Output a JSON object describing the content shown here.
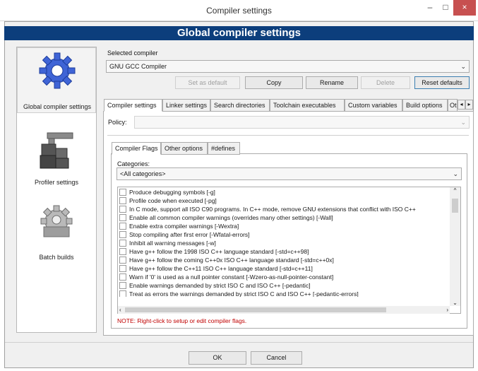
{
  "window": {
    "title": "Compiler settings",
    "minimize": "–",
    "maximize": "□",
    "close": "×"
  },
  "banner": "Global compiler settings",
  "sidebar": {
    "items": [
      {
        "label": "Global compiler settings",
        "icon": "gear-icon",
        "selected": true
      },
      {
        "label": "Profiler settings",
        "icon": "caliper-icon",
        "selected": false
      },
      {
        "label": "Batch builds",
        "icon": "gears-icon",
        "selected": false
      }
    ]
  },
  "selected_compiler": {
    "label": "Selected compiler",
    "value": "GNU GCC Compiler",
    "buttons": {
      "set_default": "Set as default",
      "copy": "Copy",
      "rename": "Rename",
      "delete": "Delete",
      "reset": "Reset defaults"
    }
  },
  "tabs": [
    "Compiler settings",
    "Linker settings",
    "Search directories",
    "Toolchain executables",
    "Custom variables",
    "Build options",
    "Other settings"
  ],
  "policy": {
    "label": "Policy:",
    "value": ""
  },
  "subtabs": [
    "Compiler Flags",
    "Other options",
    "#defines"
  ],
  "categories": {
    "label": "Categories:",
    "value": "<All categories>"
  },
  "flags": [
    "Produce debugging symbols  [-g]",
    "Profile code when executed  [-pg]",
    "In C mode, support all ISO C90 programs. In C++ mode, remove GNU extensions that conflict with ISO C++",
    "Enable all common compiler warnings (overrides many other settings)  [-Wall]",
    "Enable extra compiler warnings  [-Wextra]",
    "Stop compiling after first error  [-Wfatal-errors]",
    "Inhibit all warning messages  [-w]",
    "Have g++ follow the 1998 ISO C++ language standard  [-std=c++98]",
    "Have g++ follow the coming C++0x ISO C++ language standard  [-std=c++0x]",
    "Have g++ follow the C++11 ISO C++ language standard  [-std=c++11]",
    "Warn if '0' is used as a null pointer constant  [-Wzero-as-null-pointer-constant]",
    "Enable warnings demanded by strict ISO C and ISO C++  [-pedantic]",
    "Treat as errors the warnings demanded by strict ISO C and ISO C++  [-pedantic-errors]"
  ],
  "note": "NOTE: Right-click to setup or edit compiler flags.",
  "footer": {
    "ok": "OK",
    "cancel": "Cancel"
  }
}
